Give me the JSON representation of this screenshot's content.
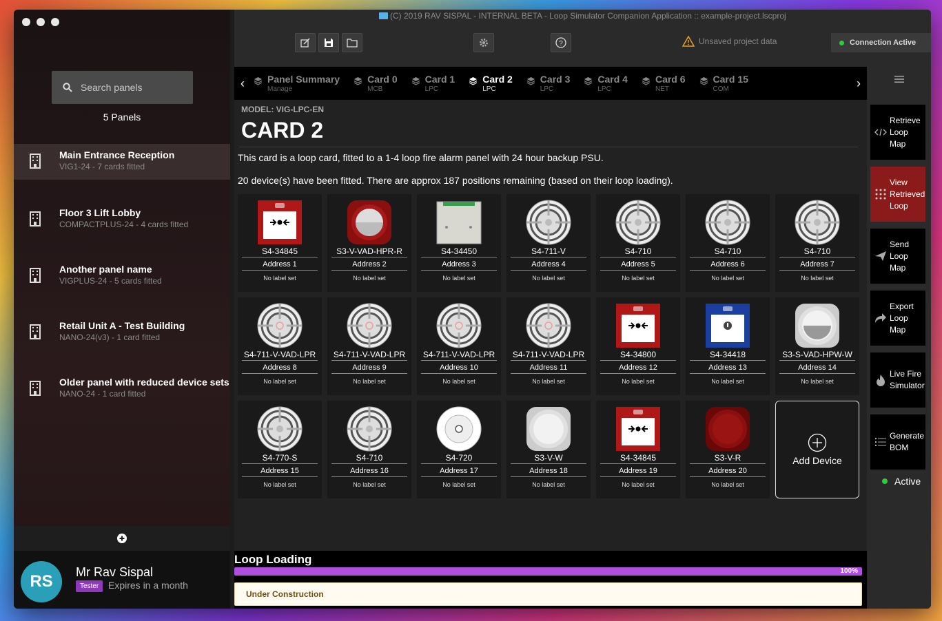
{
  "window_title": "(C) 2019 RAV SISPAL - INTERNAL BETA - Loop Simulator Companion Application :: example-project.lscproj",
  "sidebar": {
    "search_placeholder": "Search panels",
    "panel_count": "5 Panels",
    "panels": [
      {
        "name": "Main Entrance Reception",
        "sub": "VIG1-24 - 7 cards fitted"
      },
      {
        "name": "Floor 3 Lift Lobby",
        "sub": "COMPACTPLUS-24 - 4 cards fitted"
      },
      {
        "name": "Another panel name",
        "sub": "VIGPLUS-24 - 5 cards fitted"
      },
      {
        "name": "Retail Unit A - Test Building",
        "sub": "NANO-24(v3) - 1 card fitted"
      },
      {
        "name": "Older panel with reduced device sets",
        "sub": "NANO-24 - 1 card fitted"
      }
    ]
  },
  "user": {
    "initials": "RS",
    "name": "Mr Rav Sispal",
    "badge": "Tester",
    "expires": "Expires in a month"
  },
  "toolbar": {
    "unsaved": "Unsaved project data",
    "connection": "Connection Active"
  },
  "tabs": [
    {
      "label": "Panel Summary",
      "sub": "Manage"
    },
    {
      "label": "Card 0",
      "sub": "MCB"
    },
    {
      "label": "Card 1",
      "sub": "LPC"
    },
    {
      "label": "Card 2",
      "sub": "LPC"
    },
    {
      "label": "Card 3",
      "sub": "LPC"
    },
    {
      "label": "Card 4",
      "sub": "LPC"
    },
    {
      "label": "Card 6",
      "sub": "NET"
    },
    {
      "label": "Card 15",
      "sub": "COM"
    }
  ],
  "card": {
    "model": "MODEL: VIG-LPC-EN",
    "title": "CARD 2",
    "desc1": "This card is a loop card, fitted to a 1-4 loop fire alarm panel with 24 hour backup PSU.",
    "desc2": "20 device(s) have been fitted. There are approx 187 positions remaining (based on their loop loading)."
  },
  "devices": [
    {
      "name": "S4-34845",
      "addr": "Address 1",
      "label": "No label set",
      "kind": "callpoint-red"
    },
    {
      "name": "S3-V-VAD-HPR-R",
      "addr": "Address 2",
      "label": "No label set",
      "kind": "sounder-red"
    },
    {
      "name": "S4-34450",
      "addr": "Address 3",
      "label": "No label set",
      "kind": "module"
    },
    {
      "name": "S4-711-V",
      "addr": "Address 4",
      "label": "No label set",
      "kind": "detector"
    },
    {
      "name": "S4-710",
      "addr": "Address 5",
      "label": "No label set",
      "kind": "detector"
    },
    {
      "name": "S4-710",
      "addr": "Address 6",
      "label": "No label set",
      "kind": "detector"
    },
    {
      "name": "S4-710",
      "addr": "Address 7",
      "label": "No label set",
      "kind": "detector"
    },
    {
      "name": "S4-711-V-VAD-LPR",
      "addr": "Address 8",
      "label": "No label set",
      "kind": "detector-vad"
    },
    {
      "name": "S4-711-V-VAD-LPR",
      "addr": "Address 9",
      "label": "No label set",
      "kind": "detector-vad"
    },
    {
      "name": "S4-711-V-VAD-LPR",
      "addr": "Address 10",
      "label": "No label set",
      "kind": "detector-vad"
    },
    {
      "name": "S4-711-V-VAD-LPR",
      "addr": "Address 11",
      "label": "No label set",
      "kind": "detector-vad"
    },
    {
      "name": "S4-34800",
      "addr": "Address 12",
      "label": "No label set",
      "kind": "callpoint-red"
    },
    {
      "name": "S4-34418",
      "addr": "Address 13",
      "label": "No label set",
      "kind": "callpoint-blue"
    },
    {
      "name": "S3-S-VAD-HPW-W",
      "addr": "Address 14",
      "label": "No label set",
      "kind": "sounder-white"
    },
    {
      "name": "S4-770-S",
      "addr": "Address 15",
      "label": "No label set",
      "kind": "detector"
    },
    {
      "name": "S4-710",
      "addr": "Address 16",
      "label": "No label set",
      "kind": "detector"
    },
    {
      "name": "S4-720",
      "addr": "Address 17",
      "label": "No label set",
      "kind": "detector-white"
    },
    {
      "name": "S3-V-W",
      "addr": "Address 18",
      "label": "No label set",
      "kind": "sounder-plain-white"
    },
    {
      "name": "S4-34845",
      "addr": "Address 19",
      "label": "No label set",
      "kind": "callpoint-red"
    },
    {
      "name": "S3-V-R",
      "addr": "Address 20",
      "label": "No label set",
      "kind": "sounder-plain-red"
    }
  ],
  "add_device": "Add Device",
  "loop": {
    "title": "Loop Loading",
    "percent": "100%",
    "percent_value": 100,
    "status": "Under Construction"
  },
  "actions": [
    {
      "line1": "Retrieve",
      "line2": "Loop Map",
      "line3": "",
      "icon": "code-icon"
    },
    {
      "line1": "View",
      "line2": "Retrieved",
      "line3": "Loop",
      "icon": "grid-icon"
    },
    {
      "line1": "Send",
      "line2": "Loop Map",
      "line3": "",
      "icon": "send-icon"
    },
    {
      "line1": "Export",
      "line2": "Loop Map",
      "line3": "",
      "icon": "share-icon"
    },
    {
      "line1": "Live Fire",
      "line2": "Simulator",
      "line3": "",
      "icon": "fire-icon"
    },
    {
      "line1": "Generate",
      "line2": "BOM",
      "line3": "",
      "icon": "list-icon"
    }
  ],
  "active_label": "Active"
}
